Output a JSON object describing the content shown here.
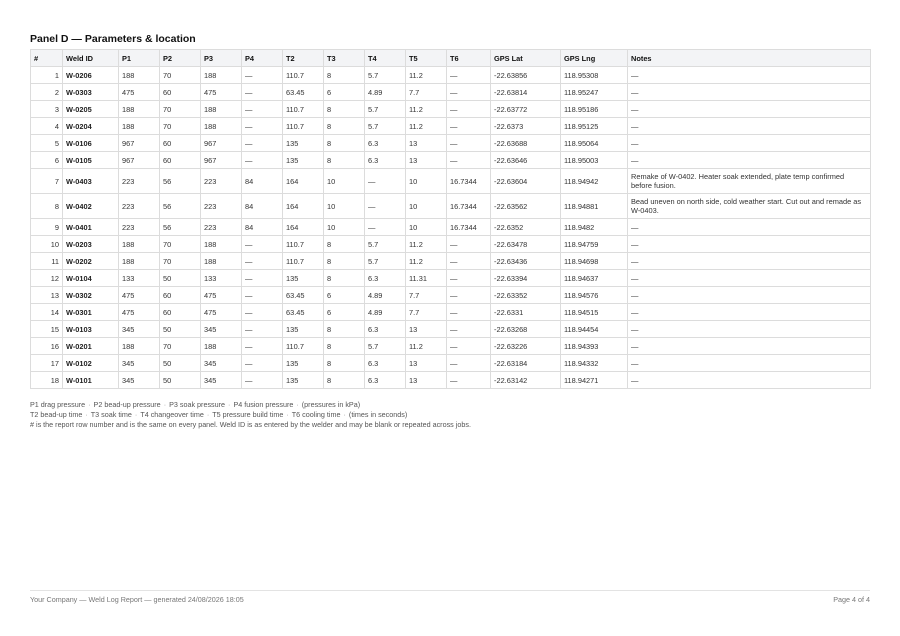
{
  "panel": {
    "title": "Panel D — Parameters & location"
  },
  "table": {
    "headers": [
      "#",
      "Weld ID",
      "P1",
      "P2",
      "P3",
      "P4",
      "T2",
      "T3",
      "T4",
      "T5",
      "T6",
      "GPS Lat",
      "GPS Lng",
      "Notes"
    ],
    "rows": [
      [
        "1",
        "W-0206",
        "188",
        "70",
        "188",
        "—",
        "110.7",
        "8",
        "5.7",
        "11.2",
        "—",
        "-22.63856",
        "118.95308",
        "—"
      ],
      [
        "2",
        "W-0303",
        "475",
        "60",
        "475",
        "—",
        "63.45",
        "6",
        "4.89",
        "7.7",
        "—",
        "-22.63814",
        "118.95247",
        "—"
      ],
      [
        "3",
        "W-0205",
        "188",
        "70",
        "188",
        "—",
        "110.7",
        "8",
        "5.7",
        "11.2",
        "—",
        "-22.63772",
        "118.95186",
        "—"
      ],
      [
        "4",
        "W-0204",
        "188",
        "70",
        "188",
        "—",
        "110.7",
        "8",
        "5.7",
        "11.2",
        "—",
        "-22.6373",
        "118.95125",
        "—"
      ],
      [
        "5",
        "W-0106",
        "967",
        "60",
        "967",
        "—",
        "135",
        "8",
        "6.3",
        "13",
        "—",
        "-22.63688",
        "118.95064",
        "—"
      ],
      [
        "6",
        "W-0105",
        "967",
        "60",
        "967",
        "—",
        "135",
        "8",
        "6.3",
        "13",
        "—",
        "-22.63646",
        "118.95003",
        "—"
      ],
      [
        "7",
        "W-0403",
        "223",
        "56",
        "223",
        "84",
        "164",
        "10",
        "—",
        "10",
        "16.7344",
        "-22.63604",
        "118.94942",
        "Remake of W-0402. Heater soak extended, plate temp confirmed before fusion."
      ],
      [
        "8",
        "W-0402",
        "223",
        "56",
        "223",
        "84",
        "164",
        "10",
        "—",
        "10",
        "16.7344",
        "-22.63562",
        "118.94881",
        "Bead uneven on north side, cold weather start. Cut out and remade as W-0403."
      ],
      [
        "9",
        "W-0401",
        "223",
        "56",
        "223",
        "84",
        "164",
        "10",
        "—",
        "10",
        "16.7344",
        "-22.6352",
        "118.9482",
        "—"
      ],
      [
        "10",
        "W-0203",
        "188",
        "70",
        "188",
        "—",
        "110.7",
        "8",
        "5.7",
        "11.2",
        "—",
        "-22.63478",
        "118.94759",
        "—"
      ],
      [
        "11",
        "W-0202",
        "188",
        "70",
        "188",
        "—",
        "110.7",
        "8",
        "5.7",
        "11.2",
        "—",
        "-22.63436",
        "118.94698",
        "—"
      ],
      [
        "12",
        "W-0104",
        "133",
        "50",
        "133",
        "—",
        "135",
        "8",
        "6.3",
        "11.31",
        "—",
        "-22.63394",
        "118.94637",
        "—"
      ],
      [
        "13",
        "W-0302",
        "475",
        "60",
        "475",
        "—",
        "63.45",
        "6",
        "4.89",
        "7.7",
        "—",
        "-22.63352",
        "118.94576",
        "—"
      ],
      [
        "14",
        "W-0301",
        "475",
        "60",
        "475",
        "—",
        "63.45",
        "6",
        "4.89",
        "7.7",
        "—",
        "-22.6331",
        "118.94515",
        "—"
      ],
      [
        "15",
        "W-0103",
        "345",
        "50",
        "345",
        "—",
        "135",
        "8",
        "6.3",
        "13",
        "—",
        "-22.63268",
        "118.94454",
        "—"
      ],
      [
        "16",
        "W-0201",
        "188",
        "70",
        "188",
        "—",
        "110.7",
        "8",
        "5.7",
        "11.2",
        "—",
        "-22.63226",
        "118.94393",
        "—"
      ],
      [
        "17",
        "W-0102",
        "345",
        "50",
        "345",
        "—",
        "135",
        "8",
        "6.3",
        "13",
        "—",
        "-22.63184",
        "118.94332",
        "—"
      ],
      [
        "18",
        "W-0101",
        "345",
        "50",
        "345",
        "—",
        "135",
        "8",
        "6.3",
        "13",
        "—",
        "-22.63142",
        "118.94271",
        "—"
      ]
    ]
  },
  "legend": {
    "line1": [
      "P1 drag pressure",
      "P2 bead-up pressure",
      "P3 soak pressure",
      "P4 fusion pressure",
      "(pressures in kPa)"
    ],
    "line2": [
      "T2 bead-up time",
      "T3 soak time",
      "T4 changeover time",
      "T5 pressure build time",
      "T6 cooling time",
      "(times in seconds)"
    ],
    "line3": "# is the report row number and is the same on every panel. Weld ID is as entered by the welder and may be blank or repeated across jobs."
  },
  "footer": {
    "left": "Your Company — Weld Log Report — generated 24/08/2026 18:05",
    "right": "Page 4 of 4"
  }
}
